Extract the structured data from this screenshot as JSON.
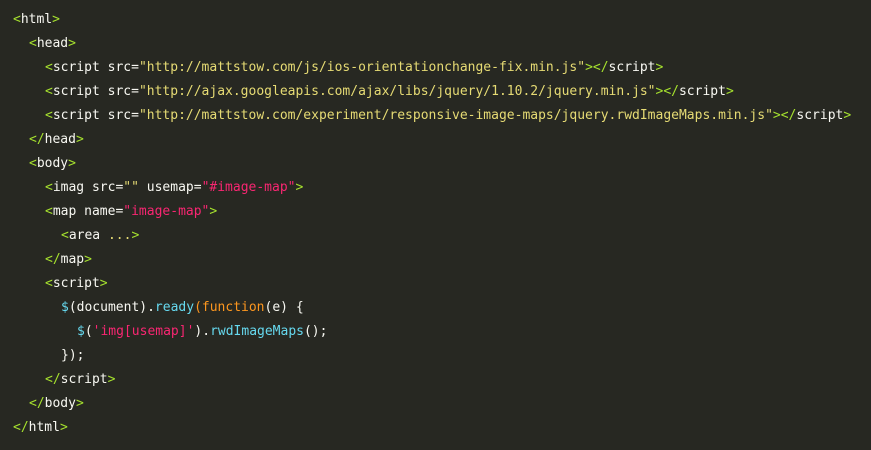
{
  "code": {
    "lines": [
      {
        "indent": 0,
        "tokens": [
          [
            "punc",
            "<"
          ],
          [
            "tag",
            "html"
          ],
          [
            "punc",
            ">"
          ]
        ]
      },
      {
        "indent": 1,
        "tokens": [
          [
            "punc",
            "<"
          ],
          [
            "tag",
            "head"
          ],
          [
            "punc",
            ">"
          ]
        ]
      },
      {
        "indent": 2,
        "tokens": [
          [
            "punc",
            "<"
          ],
          [
            "tag",
            "script"
          ],
          [
            "plain",
            " "
          ],
          [
            "attr",
            "src"
          ],
          [
            "eq",
            "="
          ],
          [
            "str",
            "\"http://mattstow.com/js/ios-orientationchange-fix.min.js\""
          ],
          [
            "punc",
            "></"
          ],
          [
            "tag",
            "script"
          ],
          [
            "punc",
            ">"
          ]
        ]
      },
      {
        "indent": 2,
        "tokens": [
          [
            "punc",
            "<"
          ],
          [
            "tag",
            "script"
          ],
          [
            "plain",
            " "
          ],
          [
            "attr",
            "src"
          ],
          [
            "eq",
            "="
          ],
          [
            "str",
            "\"http://ajax.googleapis.com/ajax/libs/jquery/1.10.2/jquery.min.js\""
          ],
          [
            "punc",
            "></"
          ],
          [
            "tag",
            "script"
          ],
          [
            "punc",
            ">"
          ]
        ]
      },
      {
        "indent": 2,
        "tokens": [
          [
            "punc",
            "<"
          ],
          [
            "tag",
            "script"
          ],
          [
            "plain",
            " "
          ],
          [
            "attr",
            "src"
          ],
          [
            "eq",
            "="
          ],
          [
            "str",
            "\"http://mattstow.com/experiment/responsive-image-maps/jquery.rwdImageMaps.min.js\""
          ],
          [
            "punc",
            "></"
          ],
          [
            "tag",
            "script"
          ],
          [
            "punc",
            ">"
          ]
        ]
      },
      {
        "indent": 1,
        "tokens": [
          [
            "punc",
            "</"
          ],
          [
            "tag",
            "head"
          ],
          [
            "punc",
            ">"
          ]
        ]
      },
      {
        "indent": 1,
        "tokens": [
          [
            "punc",
            "<"
          ],
          [
            "tag",
            "body"
          ],
          [
            "punc",
            ">"
          ]
        ]
      },
      {
        "indent": 2,
        "tokens": [
          [
            "punc",
            "<"
          ],
          [
            "tag",
            "imag"
          ],
          [
            "plain",
            " "
          ],
          [
            "attr",
            "src"
          ],
          [
            "eq",
            "="
          ],
          [
            "str",
            "\"\""
          ],
          [
            "plain",
            " "
          ],
          [
            "attr",
            "usemap"
          ],
          [
            "eq",
            "="
          ],
          [
            "pink",
            "\"#image-map\""
          ],
          [
            "punc",
            ">"
          ]
        ]
      },
      {
        "indent": 2,
        "tokens": [
          [
            "punc",
            "<"
          ],
          [
            "tag",
            "map"
          ],
          [
            "plain",
            " "
          ],
          [
            "attr",
            "name"
          ],
          [
            "eq",
            "="
          ],
          [
            "pink",
            "\"image-map\""
          ],
          [
            "punc",
            ">"
          ]
        ]
      },
      {
        "indent": 3,
        "tokens": [
          [
            "punc",
            "<"
          ],
          [
            "tag",
            "area"
          ],
          [
            "plain",
            " "
          ],
          [
            "str",
            "..."
          ],
          [
            "punc",
            ">"
          ]
        ]
      },
      {
        "indent": 2,
        "tokens": [
          [
            "punc",
            "</"
          ],
          [
            "tag",
            "map"
          ],
          [
            "punc",
            ">"
          ]
        ]
      },
      {
        "indent": 2,
        "tokens": [
          [
            "punc",
            "<"
          ],
          [
            "tag",
            "script"
          ],
          [
            "punc",
            ">"
          ]
        ]
      },
      {
        "indent": 3,
        "tokens": [
          [
            "fn",
            "$"
          ],
          [
            "plain",
            "(document)."
          ],
          [
            "fn",
            "ready"
          ],
          [
            "kw",
            "("
          ],
          [
            "kw",
            "function"
          ],
          [
            "plain",
            "(e) {"
          ]
        ]
      },
      {
        "indent": 4,
        "tokens": [
          [
            "fn",
            "$"
          ],
          [
            "plain",
            "("
          ],
          [
            "pink",
            "'img[usemap]'"
          ],
          [
            "plain",
            ")."
          ],
          [
            "fn",
            "rwdImageMaps"
          ],
          [
            "plain",
            "();"
          ]
        ]
      },
      {
        "indent": 3,
        "tokens": [
          [
            "plain",
            "});"
          ]
        ]
      },
      {
        "indent": 2,
        "tokens": [
          [
            "punc",
            "</"
          ],
          [
            "tag",
            "script"
          ],
          [
            "punc",
            ">"
          ]
        ]
      },
      {
        "indent": 1,
        "tokens": [
          [
            "punc",
            "</"
          ],
          [
            "tag",
            "body"
          ],
          [
            "punc",
            ">"
          ]
        ]
      },
      {
        "indent": 0,
        "tokens": [
          [
            "punc",
            "</"
          ],
          [
            "tag",
            "html"
          ],
          [
            "punc",
            ">"
          ]
        ]
      }
    ]
  }
}
